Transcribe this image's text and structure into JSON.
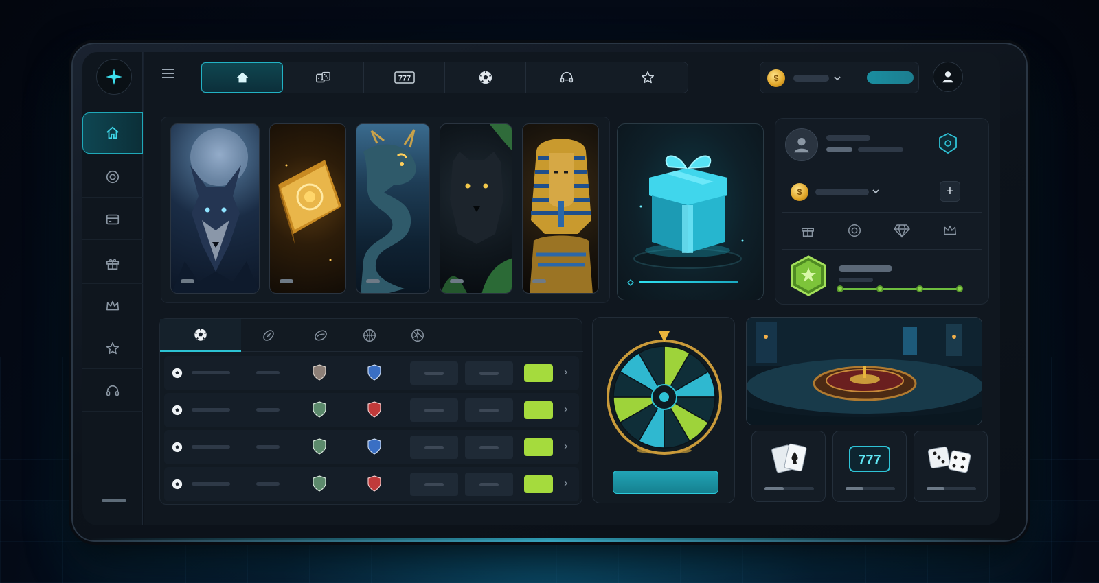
{
  "top_tabs": [
    {
      "icon": "home-icon",
      "active": true
    },
    {
      "icon": "dice-icon",
      "active": false
    },
    {
      "icon": "slots-777-icon",
      "label": "777",
      "active": false
    },
    {
      "icon": "soccer-ball-icon",
      "active": false
    },
    {
      "icon": "headset-icon",
      "active": false
    },
    {
      "icon": "star-icon",
      "active": false
    }
  ],
  "sidebar": {
    "items": [
      {
        "icon": "home-icon",
        "active": true
      },
      {
        "icon": "target-icon",
        "active": false
      },
      {
        "icon": "wallet-icon",
        "active": false
      },
      {
        "icon": "gift-icon",
        "active": false
      },
      {
        "icon": "crown-icon",
        "active": false
      },
      {
        "icon": "star-icon",
        "active": false
      },
      {
        "icon": "headset-icon",
        "active": false
      }
    ]
  },
  "featured_games": [
    {
      "theme": "wolf"
    },
    {
      "theme": "golden-book"
    },
    {
      "theme": "dragon"
    },
    {
      "theme": "panther"
    },
    {
      "theme": "pharaoh"
    }
  ],
  "profile": {
    "quick_icons": [
      "gift-icon",
      "chip-icon",
      "diamond-icon",
      "crown-icon"
    ],
    "level_steps": 4
  },
  "sports": {
    "tabs": [
      "soccer-icon",
      "football-icon",
      "rugby-icon",
      "basketball-icon",
      "volleyball-icon"
    ],
    "matches": [
      {
        "home_shield": "#8c7f77",
        "away_shield": "#3a6fc4"
      },
      {
        "home_shield": "#5c8a6c",
        "away_shield": "#c03a3a"
      },
      {
        "home_shield": "#5c8a6c",
        "away_shield": "#3a6fc4"
      },
      {
        "home_shield": "#5c8a6c",
        "away_shield": "#c03a3a"
      }
    ]
  },
  "mini_games": [
    {
      "icon": "cards-icon",
      "progress": 0.4
    },
    {
      "icon": "slot-machine-icon",
      "label": "777",
      "progress": 0.35
    },
    {
      "icon": "dice-icon",
      "progress": 0.35
    }
  ],
  "colors": {
    "accent": "#22b2c4",
    "bet": "#a5db3d",
    "level": "#8ad24a",
    "gold": "#e0a528"
  }
}
